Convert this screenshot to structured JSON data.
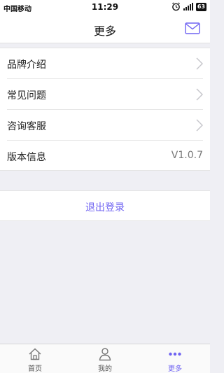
{
  "status_bar": {
    "carrier": "中国移动",
    "time": "11:29",
    "battery": "63"
  },
  "nav": {
    "title": "更多",
    "mail_icon": "mail-icon"
  },
  "menu": {
    "items": [
      {
        "label": "品牌介绍",
        "icon": "chevron-right-icon"
      },
      {
        "label": "常见问题",
        "icon": "chevron-right-icon"
      },
      {
        "label": "咨询客服",
        "icon": "chevron-right-icon"
      },
      {
        "label": "版本信息",
        "value": "V1.0.7"
      }
    ]
  },
  "logout": {
    "label": "退出登录"
  },
  "tabs": [
    {
      "label": "首页",
      "icon": "home-icon"
    },
    {
      "label": "我的",
      "icon": "user-icon"
    },
    {
      "label": "更多",
      "icon": "more-dots-icon",
      "active": true
    }
  ],
  "colors": {
    "accent": "#6f63f2",
    "background": "#efeff4"
  }
}
